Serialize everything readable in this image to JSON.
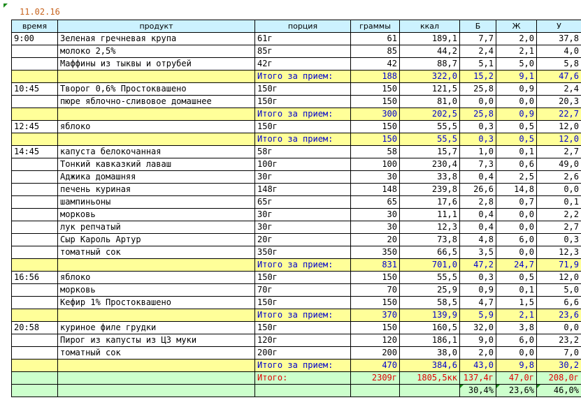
{
  "date": "11.02.16",
  "headers": [
    "время",
    "продукт",
    "порция",
    "граммы",
    "ккал",
    "Б",
    "Ж",
    "У"
  ],
  "rows": [
    {
      "type": "item",
      "time": "9:00",
      "product": "Зеленая гречневая крупа",
      "portion": "61г",
      "grams": "61",
      "kcal": "189,1",
      "b": "7,7",
      "zh": "2,0",
      "u": "37,8"
    },
    {
      "type": "item",
      "time": "",
      "product": "молоко 2,5%",
      "portion": "85г",
      "grams": "85",
      "kcal": "44,2",
      "b": "2,4",
      "zh": "2,1",
      "u": "4,0"
    },
    {
      "type": "item",
      "time": "",
      "product": "Маффины из тыквы и отрубей",
      "portion": "42г",
      "grams": "42",
      "kcal": "88,7",
      "b": "5,1",
      "zh": "5,0",
      "u": "5,8"
    },
    {
      "type": "total",
      "time": "",
      "product": "",
      "portion": "Итого за прием:",
      "grams": "188",
      "kcal": "322,0",
      "b": "15,2",
      "zh": "9,1",
      "u": "47,6"
    },
    {
      "type": "item",
      "time": "10:45",
      "product": "Творог 0,6% Простоквашено",
      "portion": "150г",
      "grams": "150",
      "kcal": "121,5",
      "b": "25,8",
      "zh": "0,9",
      "u": "2,4"
    },
    {
      "type": "item",
      "time": "",
      "product": "пюре яблочно-сливовое домашнее",
      "portion": "150г",
      "grams": "150",
      "kcal": "81,0",
      "b": "0,0",
      "zh": "0,0",
      "u": "20,3"
    },
    {
      "type": "total",
      "time": "",
      "product": "",
      "portion": "Итого за прием:",
      "grams": "300",
      "kcal": "202,5",
      "b": "25,8",
      "zh": "0,9",
      "u": "22,7"
    },
    {
      "type": "item",
      "time": "12:45",
      "product": "яблоко",
      "portion": "150г",
      "grams": "150",
      "kcal": "55,5",
      "b": "0,3",
      "zh": "0,5",
      "u": "12,0"
    },
    {
      "type": "total",
      "time": "",
      "product": "",
      "portion": "Итого за прием:",
      "grams": "150",
      "kcal": "55,5",
      "b": "0,3",
      "zh": "0,5",
      "u": "12,0"
    },
    {
      "type": "item",
      "time": "14:45",
      "product": "капуста белокочанная",
      "portion": "58г",
      "grams": "58",
      "kcal": "15,7",
      "b": "1,0",
      "zh": "0,1",
      "u": "2,7"
    },
    {
      "type": "item",
      "time": "",
      "product": "Тонкий кавказкий лаваш",
      "portion": "100г",
      "grams": "100",
      "kcal": "230,4",
      "b": "7,3",
      "zh": "0,6",
      "u": "49,0"
    },
    {
      "type": "item",
      "time": "",
      "product": "Аджика домашняя",
      "portion": "30г",
      "grams": "30",
      "kcal": "33,8",
      "b": "0,4",
      "zh": "2,5",
      "u": "2,6"
    },
    {
      "type": "item",
      "time": "",
      "product": "печень куриная",
      "portion": "148г",
      "grams": "148",
      "kcal": "239,8",
      "b": "26,6",
      "zh": "14,8",
      "u": "0,0"
    },
    {
      "type": "item",
      "time": "",
      "product": "шампиньоны",
      "portion": "65г",
      "grams": "65",
      "kcal": "17,6",
      "b": "2,8",
      "zh": "0,7",
      "u": "0,1"
    },
    {
      "type": "item",
      "time": "",
      "product": "морковь",
      "portion": "30г",
      "grams": "30",
      "kcal": "11,1",
      "b": "0,4",
      "zh": "0,0",
      "u": "2,2"
    },
    {
      "type": "item",
      "time": "",
      "product": "лук репчатый",
      "portion": "30г",
      "grams": "30",
      "kcal": "12,3",
      "b": "0,4",
      "zh": "0,0",
      "u": "2,7"
    },
    {
      "type": "item",
      "time": "",
      "product": "Сыр Кароль Артур",
      "portion": "20г",
      "grams": "20",
      "kcal": "73,8",
      "b": "4,8",
      "zh": "6,0",
      "u": "0,3"
    },
    {
      "type": "item",
      "time": "",
      "product": "томатный сок",
      "portion": "350г",
      "grams": "350",
      "kcal": "66,5",
      "b": "3,5",
      "zh": "0,0",
      "u": "12,3"
    },
    {
      "type": "total",
      "time": "",
      "product": "",
      "portion": "Итого за прием:",
      "grams": "831",
      "kcal": "701,0",
      "b": "47,2",
      "zh": "24,7",
      "u": "71,9"
    },
    {
      "type": "item",
      "time": "16:56",
      "product": "яблоко",
      "portion": "150г",
      "grams": "150",
      "kcal": "55,5",
      "b": "0,3",
      "zh": "0,5",
      "u": "12,0"
    },
    {
      "type": "item",
      "time": "",
      "product": "морковь",
      "portion": "70г",
      "grams": "70",
      "kcal": "25,9",
      "b": "0,9",
      "zh": "0,1",
      "u": "5,0"
    },
    {
      "type": "item",
      "time": "",
      "product": "Кефир 1% Простоквашено",
      "portion": "150г",
      "grams": "150",
      "kcal": "58,5",
      "b": "4,7",
      "zh": "1,5",
      "u": "6,6"
    },
    {
      "type": "total",
      "time": "",
      "product": "",
      "portion": "Итого за прием:",
      "grams": "370",
      "kcal": "139,9",
      "b": "5,9",
      "zh": "2,1",
      "u": "23,6"
    },
    {
      "type": "item",
      "time": "20:58",
      "product": "куриное филе грудки",
      "portion": "150г",
      "grams": "150",
      "kcal": "160,5",
      "b": "32,0",
      "zh": "3,8",
      "u": "0,0"
    },
    {
      "type": "item",
      "time": "",
      "product": "Пирог из капусты из ЦЗ муки",
      "portion": "120г",
      "grams": "120",
      "kcal": "186,1",
      "b": "9,0",
      "zh": "6,0",
      "u": "23,2"
    },
    {
      "type": "item",
      "time": "",
      "product": "томатный сок",
      "portion": "200г",
      "grams": "200",
      "kcal": "38,0",
      "b": "2,0",
      "zh": "0,0",
      "u": "7,0"
    },
    {
      "type": "total",
      "time": "",
      "product": "",
      "portion": "Итого за прием:",
      "grams": "470",
      "kcal": "384,6",
      "b": "43,0",
      "zh": "9,8",
      "u": "30,2"
    }
  ],
  "grand_total": {
    "label": "Итого:",
    "grams": "2309г",
    "kcal": "1805,5кк",
    "b": "137,4г",
    "zh": "47,0г",
    "u": "208,0г"
  },
  "percentages": {
    "b": "30,4%",
    "zh": "23,6%",
    "u": "46,0%"
  },
  "colors": {
    "header": "#ccf2ff",
    "total_row": "#ffff99",
    "grand_row": "#ccffcc",
    "date": "#c8641e",
    "total_text": "#0000cc",
    "grand_text": "#e00000"
  }
}
